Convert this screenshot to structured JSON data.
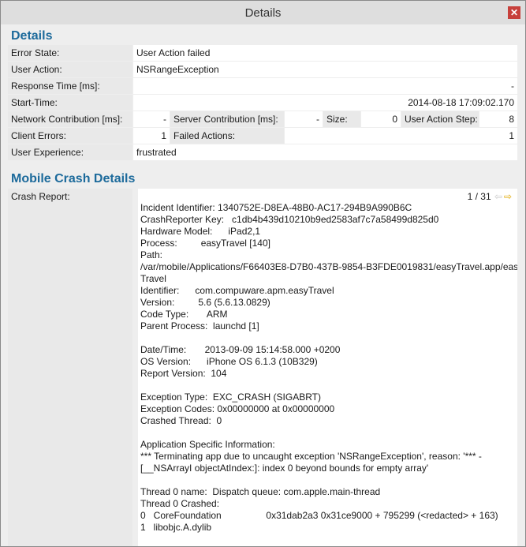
{
  "window": {
    "title": "Details",
    "close_glyph": "✕"
  },
  "details": {
    "heading": "Details",
    "error_state": {
      "label": "Error State:",
      "value": "User Action failed"
    },
    "user_action": {
      "label": "User Action:",
      "value": "NSRangeException"
    },
    "response_time": {
      "label": "Response Time [ms]:",
      "value": "-"
    },
    "start_time": {
      "label": "Start-Time:",
      "value": "2014-08-18 17:09:02.170"
    },
    "network_contribution": {
      "label": "Network Contribution [ms]:",
      "value": "-"
    },
    "server_contribution": {
      "label": "Server Contribution [ms]:",
      "value": "-"
    },
    "size": {
      "label": "Size:",
      "value": "0"
    },
    "user_action_step": {
      "label": "User Action Step:",
      "value": "8"
    },
    "client_errors": {
      "label": "Client Errors:",
      "value": "1"
    },
    "failed_actions": {
      "label": "Failed Actions:",
      "value": "1"
    },
    "user_experience": {
      "label": "User Experience:",
      "value": "frustrated"
    }
  },
  "crash": {
    "heading": "Mobile Crash Details",
    "label": "Crash Report:",
    "pager": {
      "text": "1 / 31",
      "prev_icon": "arrow-left-icon",
      "next_icon": "arrow-right-icon"
    },
    "lines": [
      "Incident Identifier: 1340752E-D8EA-48B0-AC17-294B9A990B6C",
      "CrashReporter Key:   c1db4b439d10210b9ed2583af7c7a58499d825d0",
      "Hardware Model:      iPad2,1",
      "Process:         easyTravel [140]",
      "Path:",
      "/var/mobile/Applications/F66403E8-D7B0-437B-9854-B3FDE0019831/easyTravel.app/easy",
      "Travel",
      "Identifier:      com.compuware.apm.easyTravel",
      "Version:         5.6 (5.6.13.0829)",
      "Code Type:       ARM",
      "Parent Process:  launchd [1]",
      "",
      "Date/Time:       2013-09-09 15:14:58.000 +0200",
      "OS Version:      iPhone OS 6.1.3 (10B329)",
      "Report Version:  104",
      "",
      "Exception Type:  EXC_CRASH (SIGABRT)",
      "Exception Codes: 0x00000000 at 0x00000000",
      "Crashed Thread:  0",
      "",
      "Application Specific Information:",
      "*** Terminating app due to uncaught exception 'NSRangeException', reason: '*** -",
      "[__NSArrayI objectAtIndex:]: index 0 beyond bounds for empty array'",
      "",
      "Thread 0 name:  Dispatch queue: com.apple.main-thread",
      "Thread 0 Crashed:",
      "0   CoreFoundation                 0x31dab2a3 0x31ce9000 + 795299 (<redacted> + 163)",
      "1   libobjc.A.dylib"
    ]
  }
}
